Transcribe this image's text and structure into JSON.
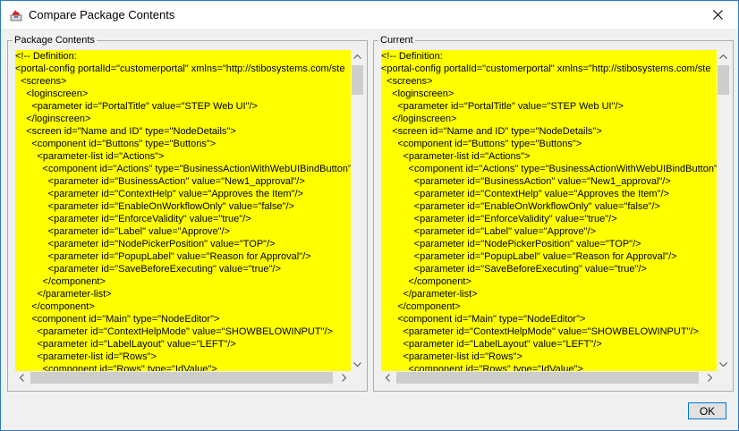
{
  "window": {
    "title": "Compare Package Contents"
  },
  "panels": {
    "left": {
      "label": "Package Contents",
      "lines": [
        "<!-- Definition:",
        "<portal-config portalId=\"customerportal\" xmlns=\"http://stibosystems.com/ste",
        "  <screens>",
        "    <loginscreen>",
        "      <parameter id=\"PortalTitle\" value=\"STEP Web UI\"/>",
        "    </loginscreen>",
        "    <screen id=\"Name and ID\" type=\"NodeDetails\">",
        "      <component id=\"Buttons\" type=\"Buttons\">",
        "        <parameter-list id=\"Actions\">",
        "          <component id=\"Actions\" type=\"BusinessActionWithWebUIBindButton\"",
        "            <parameter id=\"BusinessAction\" value=\"New1_approval\"/>",
        "            <parameter id=\"ContextHelp\" value=\"Approves the Item\"/>",
        "            <parameter id=\"EnableOnWorkflowOnly\" value=\"false\"/>",
        "            <parameter id=\"EnforceValidity\" value=\"true\"/>",
        "            <parameter id=\"Label\" value=\"Approve\"/>",
        "            <parameter id=\"NodePickerPosition\" value=\"TOP\"/>",
        "            <parameter id=\"PopupLabel\" value=\"Reason for Approval\"/>",
        "            <parameter id=\"SaveBeforeExecuting\" value=\"true\"/>",
        "          </component>",
        "        </parameter-list>",
        "      </component>",
        "      <component id=\"Main\" type=\"NodeEditor\">",
        "        <parameter id=\"ContextHelpMode\" value=\"SHOWBELOWINPUT\"/>",
        "        <parameter id=\"LabelLayout\" value=\"LEFT\"/>",
        "        <parameter-list id=\"Rows\">",
        "          <component id=\"Rows\" type=\"IdValue\">"
      ]
    },
    "right": {
      "label": "Current",
      "lines": [
        "<!-- Definition:",
        "<portal-config portalId=\"customerportal\" xmlns=\"http://stibosystems.com/ste",
        "  <screens>",
        "    <loginscreen>",
        "      <parameter id=\"PortalTitle\" value=\"STEP Web UI\"/>",
        "    </loginscreen>",
        "    <screen id=\"Name and ID\" type=\"NodeDetails\">",
        "      <component id=\"Buttons\" type=\"Buttons\">",
        "        <parameter-list id=\"Actions\">",
        "          <component id=\"Actions\" type=\"BusinessActionWithWebUIBindButton\"",
        "            <parameter id=\"BusinessAction\" value=\"New1_approval\"/>",
        "            <parameter id=\"ContextHelp\" value=\"Approves the Item\"/>",
        "            <parameter id=\"EnableOnWorkflowOnly\" value=\"false\"/>",
        "            <parameter id=\"EnforceValidity\" value=\"true\"/>",
        "            <parameter id=\"Label\" value=\"Approve\"/>",
        "            <parameter id=\"NodePickerPosition\" value=\"TOP\"/>",
        "            <parameter id=\"PopupLabel\" value=\"Reason for Approval\"/>",
        "            <parameter id=\"SaveBeforeExecuting\" value=\"true\"/>",
        "          </component>",
        "        </parameter-list>",
        "      </component>",
        "      <component id=\"Main\" type=\"NodeEditor\">",
        "        <parameter id=\"ContextHelpMode\" value=\"SHOWBELOWINPUT\"/>",
        "        <parameter id=\"LabelLayout\" value=\"LEFT\"/>",
        "        <parameter-list id=\"Rows\">",
        "          <component id=\"Rows\" type=\"IdValue\">"
      ]
    }
  },
  "buttons": {
    "ok": "OK"
  },
  "colors": {
    "highlight": "#ffff00",
    "accent": "#0078d7"
  },
  "icons": {
    "app": "java-app-icon",
    "close": "close-icon"
  }
}
